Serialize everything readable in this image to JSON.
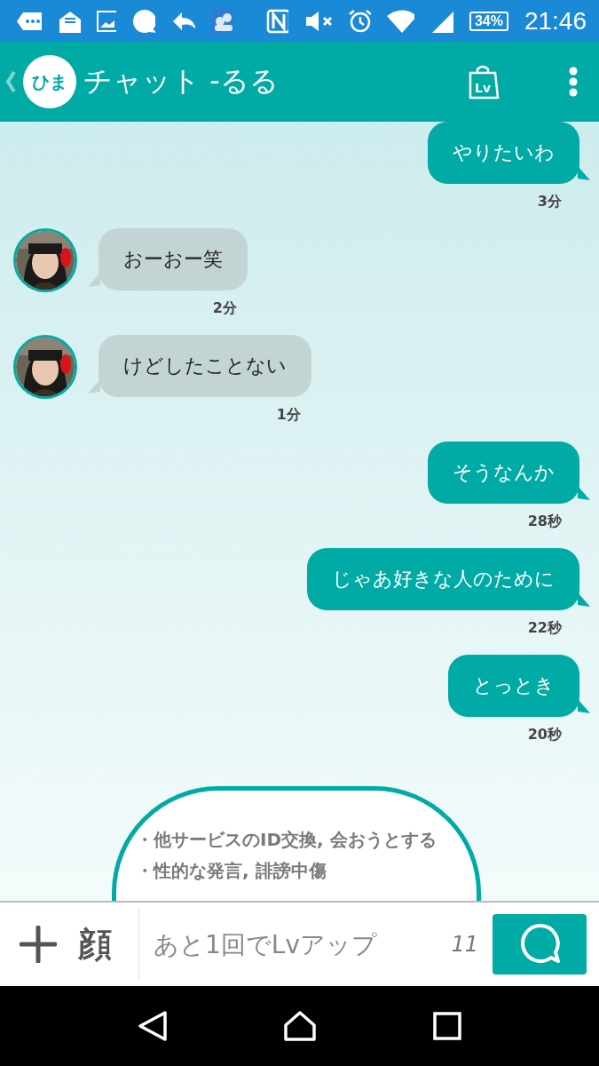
{
  "status_bar": {
    "battery": "34%",
    "time": "21:46"
  },
  "header": {
    "logo": "ひま",
    "title": "チャット -るる",
    "level_badge": "Lv"
  },
  "messages": [
    {
      "kind": "sent",
      "text": "やりたいわ",
      "time": "3分"
    },
    {
      "kind": "received",
      "text": "おーおー笑",
      "time": "2分"
    },
    {
      "kind": "received",
      "text": "けどしたことない",
      "time": "1分"
    },
    {
      "kind": "sent",
      "text": "そうなんか",
      "time": "28秒"
    },
    {
      "kind": "sent",
      "text": "じゃあ好きな人のために",
      "time": "22秒"
    },
    {
      "kind": "sent",
      "text": "とっとき",
      "time": "20秒"
    }
  ],
  "notice": {
    "lines": [
      "・他サービスのID交換, 会おうとする",
      "・性的な発言, 誹謗中傷"
    ]
  },
  "composer": {
    "face_button": "顔",
    "placeholder": "あと1回でLvアップ",
    "count": "11"
  }
}
